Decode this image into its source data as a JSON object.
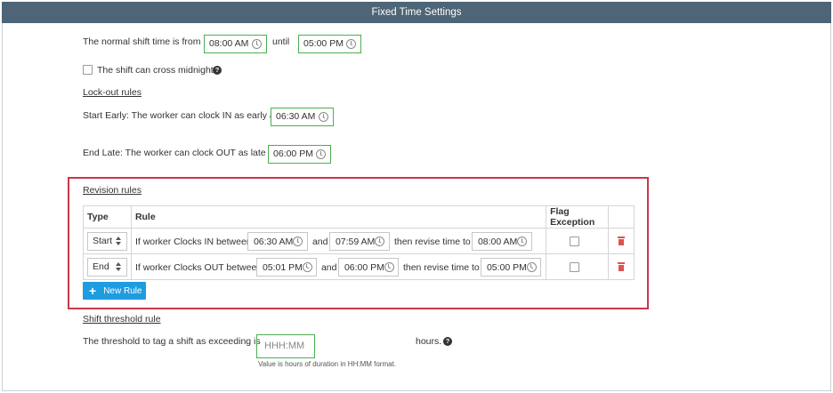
{
  "header": {
    "title": "Fixed Time Settings"
  },
  "shift": {
    "label": "The normal shift time is from",
    "start": "08:00 AM",
    "until_label": "until",
    "end": "05:00 PM",
    "cross_midnight_label": "The shift can cross midnight",
    "cross_midnight_checked": false
  },
  "lockout": {
    "heading": "Lock-out rules",
    "early_label": "Start Early: The worker can clock IN as early as",
    "early_value": "06:30 AM",
    "late_label": "End Late: The worker can clock OUT as late as",
    "late_value": "06:00 PM"
  },
  "revision": {
    "heading": "Revision rules",
    "columns": {
      "type": "Type",
      "rule": "Rule",
      "flag": "Flag Exception"
    },
    "rows": [
      {
        "type": "Start",
        "prefix": "If worker Clocks IN between",
        "from": "06:30 AM",
        "and": "and",
        "to": "07:59 AM",
        "then": "then revise time to",
        "revise": "08:00 AM",
        "flag": false
      },
      {
        "type": "End",
        "prefix": "If worker Clocks OUT between",
        "from": "05:01 PM",
        "and": "and",
        "to": "06:00 PM",
        "then": "then revise time to",
        "revise": "05:00 PM",
        "flag": false
      }
    ],
    "new_rule_label": "New Rule"
  },
  "threshold": {
    "heading": "Shift threshold rule",
    "label": "The threshold to tag a shift as exceeding is",
    "placeholder": "HHH:MM",
    "unit": "hours.",
    "hint": "Value is hours of duration in HH:MM format."
  },
  "colors": {
    "header_bg": "#4d6576",
    "field_border": "#4caf50",
    "highlight_border": "#c8374a",
    "button_bg": "#1e9ce0",
    "delete_icon": "#e05252"
  }
}
